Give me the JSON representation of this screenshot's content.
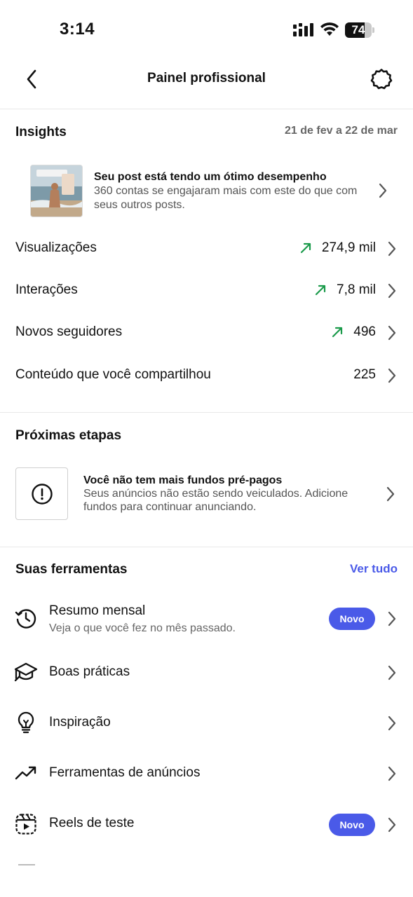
{
  "status_bar": {
    "time": "3:14",
    "battery": "74",
    "battery_level": 0.74
  },
  "header": {
    "title": "Painel profissional",
    "back_icon": "chevron-left-icon",
    "settings_icon": "gear-icon"
  },
  "insights": {
    "title": "Insights",
    "date_range": "21 de fev a 22 de mar",
    "featured": {
      "title": "Seu post está tendo um ótimo desempenho",
      "description": "360 contas se engajaram mais com este do que com seus outros posts."
    },
    "metrics": [
      {
        "label": "Visualizações",
        "value": "274,9 mil",
        "trend": "up"
      },
      {
        "label": "Interações",
        "value": "7,8 mil",
        "trend": "up"
      },
      {
        "label": "Novos seguidores",
        "value": "496",
        "trend": "up"
      },
      {
        "label": "Conteúdo que você compartilhou",
        "value": "225",
        "trend": "none"
      }
    ],
    "trend_color": "#1a9a4a"
  },
  "next_steps": {
    "title": "Próximas etapas",
    "alert": {
      "title": "Você não tem mais fundos pré-pagos",
      "description": "Seus anúncios não estão sendo veiculados. Adicione fundos para continuar anunciando.",
      "icon": "exclamation-circle-icon"
    }
  },
  "tools": {
    "title": "Suas ferramentas",
    "see_all": "Ver tudo",
    "accent": "#4a5ae8",
    "items": [
      {
        "label": "Resumo mensal",
        "subtitle": "Veja o que você fez no mês passado.",
        "badge": "Novo",
        "icon": "history-clock-icon"
      },
      {
        "label": "Boas práticas",
        "icon": "graduation-cap-icon"
      },
      {
        "label": "Inspiração",
        "icon": "lightbulb-icon"
      },
      {
        "label": "Ferramentas de anúncios",
        "icon": "trending-up-icon"
      },
      {
        "label": "Reels de teste",
        "badge": "Novo",
        "icon": "reels-icon"
      }
    ]
  }
}
